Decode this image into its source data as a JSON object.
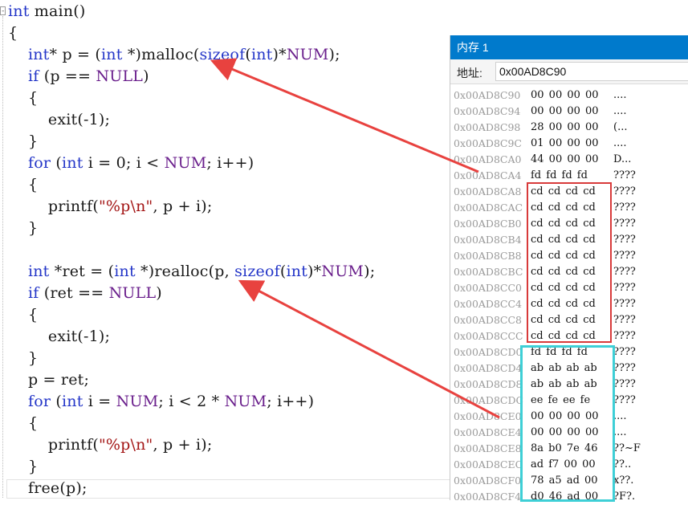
{
  "code": {
    "collapse_glyph": "-",
    "lines": [
      {
        "tokens": [
          {
            "t": "int",
            "c": "kw"
          },
          {
            "t": " main()",
            "c": "fn"
          }
        ]
      },
      {
        "tokens": [
          {
            "t": "{",
            "c": "fn"
          }
        ]
      },
      {
        "tokens": [
          {
            "t": "    int",
            "c": "kw"
          },
          {
            "t": "* p = (",
            "c": "fn"
          },
          {
            "t": "int",
            "c": "kw"
          },
          {
            "t": " *)malloc(",
            "c": "fn"
          },
          {
            "t": "sizeof",
            "c": "kw"
          },
          {
            "t": "(",
            "c": "fn"
          },
          {
            "t": "int",
            "c": "kw"
          },
          {
            "t": ")*",
            "c": "fn"
          },
          {
            "t": "NUM",
            "c": "mac"
          },
          {
            "t": ");",
            "c": "fn"
          }
        ]
      },
      {
        "tokens": [
          {
            "t": "    if",
            "c": "kw"
          },
          {
            "t": " (p == ",
            "c": "fn"
          },
          {
            "t": "NULL",
            "c": "mac"
          },
          {
            "t": ")",
            "c": "fn"
          }
        ]
      },
      {
        "tokens": [
          {
            "t": "    {",
            "c": "fn"
          }
        ]
      },
      {
        "tokens": [
          {
            "t": "        exit(-1);",
            "c": "fn"
          }
        ]
      },
      {
        "tokens": [
          {
            "t": "    }",
            "c": "fn"
          }
        ]
      },
      {
        "tokens": [
          {
            "t": "    for",
            "c": "kw"
          },
          {
            "t": " (",
            "c": "fn"
          },
          {
            "t": "int",
            "c": "kw"
          },
          {
            "t": " i = 0; i < ",
            "c": "fn"
          },
          {
            "t": "NUM",
            "c": "mac"
          },
          {
            "t": "; i++)",
            "c": "fn"
          }
        ]
      },
      {
        "tokens": [
          {
            "t": "    {",
            "c": "fn"
          }
        ]
      },
      {
        "tokens": [
          {
            "t": "        printf(",
            "c": "fn"
          },
          {
            "t": "\"%p\\n\"",
            "c": "str"
          },
          {
            "t": ", p + i);",
            "c": "fn"
          }
        ]
      },
      {
        "tokens": [
          {
            "t": "    }",
            "c": "fn"
          }
        ]
      },
      {
        "tokens": [
          {
            "t": "",
            "c": "fn"
          }
        ]
      },
      {
        "tokens": [
          {
            "t": "    int",
            "c": "kw"
          },
          {
            "t": " *ret = (",
            "c": "fn"
          },
          {
            "t": "int",
            "c": "kw"
          },
          {
            "t": " *)realloc(p, ",
            "c": "fn"
          },
          {
            "t": "sizeof",
            "c": "kw"
          },
          {
            "t": "(",
            "c": "fn"
          },
          {
            "t": "int",
            "c": "kw"
          },
          {
            "t": ")*",
            "c": "fn"
          },
          {
            "t": "NUM",
            "c": "mac"
          },
          {
            "t": ");",
            "c": "fn"
          }
        ]
      },
      {
        "tokens": [
          {
            "t": "    if",
            "c": "kw"
          },
          {
            "t": " (ret == ",
            "c": "fn"
          },
          {
            "t": "NULL",
            "c": "mac"
          },
          {
            "t": ")",
            "c": "fn"
          }
        ]
      },
      {
        "tokens": [
          {
            "t": "    {",
            "c": "fn"
          }
        ]
      },
      {
        "tokens": [
          {
            "t": "        exit(-1);",
            "c": "fn"
          }
        ]
      },
      {
        "tokens": [
          {
            "t": "    }",
            "c": "fn"
          }
        ]
      },
      {
        "tokens": [
          {
            "t": "    p = ret;",
            "c": "fn"
          }
        ]
      },
      {
        "tokens": [
          {
            "t": "    for",
            "c": "kw"
          },
          {
            "t": " (",
            "c": "fn"
          },
          {
            "t": "int",
            "c": "kw"
          },
          {
            "t": " i = ",
            "c": "fn"
          },
          {
            "t": "NUM",
            "c": "mac"
          },
          {
            "t": "; i < 2 * ",
            "c": "fn"
          },
          {
            "t": "NUM",
            "c": "mac"
          },
          {
            "t": "; i++)",
            "c": "fn"
          }
        ]
      },
      {
        "tokens": [
          {
            "t": "    {",
            "c": "fn"
          }
        ]
      },
      {
        "tokens": [
          {
            "t": "        printf(",
            "c": "fn"
          },
          {
            "t": "\"%p\\n\"",
            "c": "str"
          },
          {
            "t": ", p + i);",
            "c": "fn"
          }
        ]
      },
      {
        "tokens": [
          {
            "t": "    }",
            "c": "fn"
          }
        ]
      },
      {
        "tokens": [
          {
            "t": "    free(p);",
            "c": "fn"
          }
        ]
      }
    ]
  },
  "memory": {
    "title": "内存 1",
    "address_label": "地址:",
    "address_value": "0x00AD8C90",
    "rows": [
      {
        "addr": "0x00AD8C90",
        "bytes": "00 00 00 00",
        "ascii": "...."
      },
      {
        "addr": "0x00AD8C94",
        "bytes": "00 00 00 00",
        "ascii": "...."
      },
      {
        "addr": "0x00AD8C98",
        "bytes": "28 00 00 00",
        "ascii": "(..."
      },
      {
        "addr": "0x00AD8C9C",
        "bytes": "01 00 00 00",
        "ascii": "...."
      },
      {
        "addr": "0x00AD8CA0",
        "bytes": "44 00 00 00",
        "ascii": "D..."
      },
      {
        "addr": "0x00AD8CA4",
        "bytes": "fd fd fd fd",
        "ascii": "????"
      },
      {
        "addr": "0x00AD8CA8",
        "bytes": "cd cd cd cd",
        "ascii": "????"
      },
      {
        "addr": "0x00AD8CAC",
        "bytes": "cd cd cd cd",
        "ascii": "????"
      },
      {
        "addr": "0x00AD8CB0",
        "bytes": "cd cd cd cd",
        "ascii": "????"
      },
      {
        "addr": "0x00AD8CB4",
        "bytes": "cd cd cd cd",
        "ascii": "????"
      },
      {
        "addr": "0x00AD8CB8",
        "bytes": "cd cd cd cd",
        "ascii": "????"
      },
      {
        "addr": "0x00AD8CBC",
        "bytes": "cd cd cd cd",
        "ascii": "????"
      },
      {
        "addr": "0x00AD8CC0",
        "bytes": "cd cd cd cd",
        "ascii": "????"
      },
      {
        "addr": "0x00AD8CC4",
        "bytes": "cd cd cd cd",
        "ascii": "????"
      },
      {
        "addr": "0x00AD8CC8",
        "bytes": "cd cd cd cd",
        "ascii": "????"
      },
      {
        "addr": "0x00AD8CCC",
        "bytes": "cd cd cd cd",
        "ascii": "????"
      },
      {
        "addr": "0x00AD8CD0",
        "bytes": "fd fd fd fd",
        "ascii": "????"
      },
      {
        "addr": "0x00AD8CD4",
        "bytes": "ab ab ab ab",
        "ascii": "????"
      },
      {
        "addr": "0x00AD8CD8",
        "bytes": "ab ab ab ab",
        "ascii": "????"
      },
      {
        "addr": "0x00AD8CDC",
        "bytes": "ee fe ee fe",
        "ascii": "????"
      },
      {
        "addr": "0x00AD8CE0",
        "bytes": "00 00 00 00",
        "ascii": "...."
      },
      {
        "addr": "0x00AD8CE4",
        "bytes": "00 00 00 00",
        "ascii": "...."
      },
      {
        "addr": "0x00AD8CE8",
        "bytes": "8a b0 7e 46",
        "ascii": "??~F"
      },
      {
        "addr": "0x00AD8CEC",
        "bytes": "ad f7 00 00",
        "ascii": "??.."
      },
      {
        "addr": "0x00AD8CF0",
        "bytes": "78 a5 ad 00",
        "ascii": "x??."
      },
      {
        "addr": "0x00AD8CF4",
        "bytes": "d0 46 ad 00",
        "ascii": "?F?."
      }
    ]
  },
  "annotation_colors": {
    "arrow": "#e8423f",
    "red_box": "#d83a3a",
    "cyan_box": "#3ecfd6"
  }
}
